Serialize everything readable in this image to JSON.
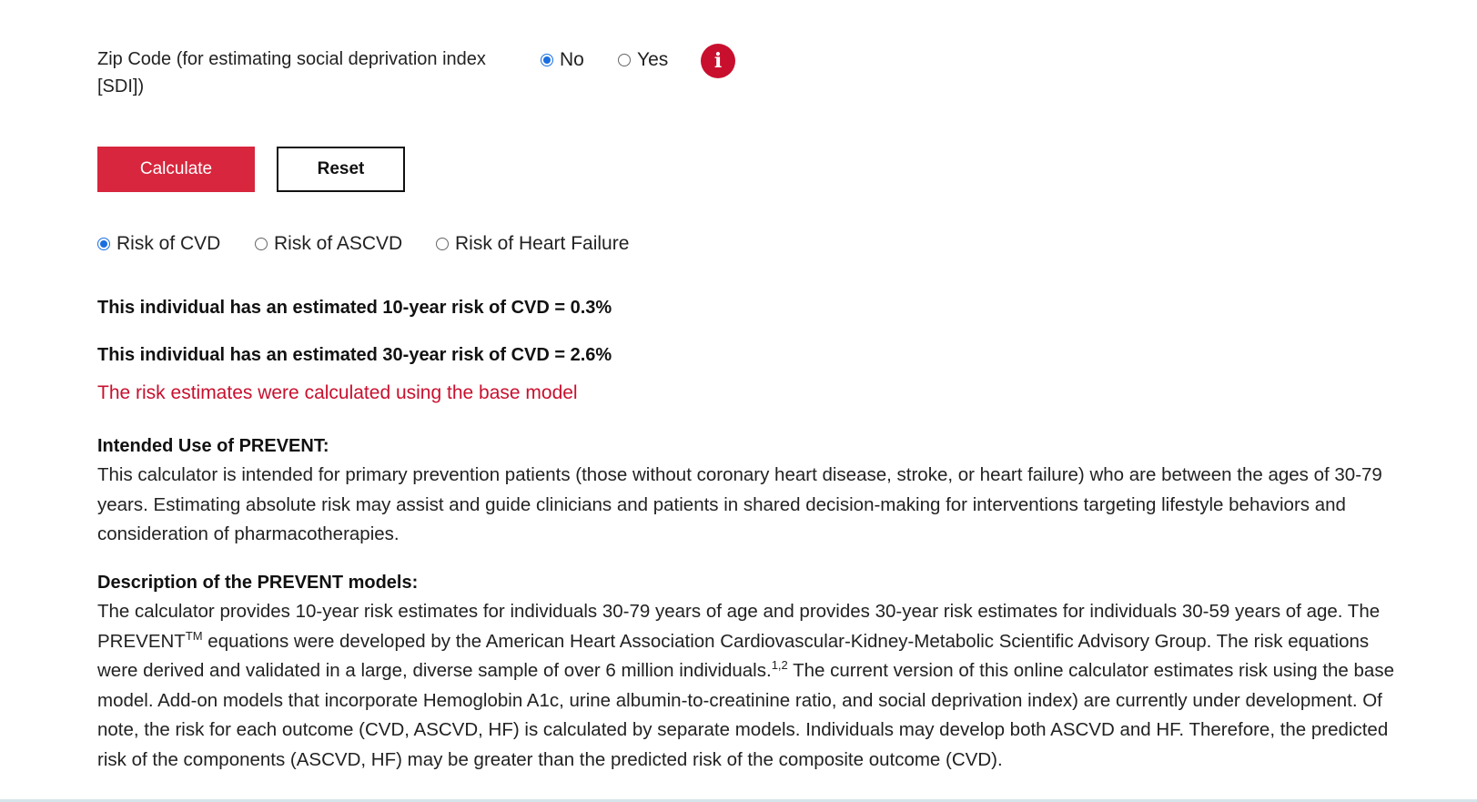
{
  "zip": {
    "label": "Zip Code (for estimating social deprivation index [SDI])",
    "option_no": "No",
    "option_yes": "Yes",
    "selected": "No",
    "info_glyph": "i"
  },
  "buttons": {
    "calculate": "Calculate",
    "reset": "Reset"
  },
  "risk_tabs": {
    "cvd": "Risk of CVD",
    "ascvd": "Risk of ASCVD",
    "hf": "Risk of Heart Failure",
    "selected": "Risk of CVD"
  },
  "results": {
    "ten_year": "This individual has an estimated 10-year risk of CVD = 0.3%",
    "thirty_year": "This individual has an estimated 30-year risk of CVD = 2.6%",
    "model_note": "The risk estimates were calculated using the base model"
  },
  "intended_use": {
    "heading": "Intended Use of PREVENT:",
    "body": "This calculator is intended for primary prevention patients (those without coronary heart disease, stroke, or heart failure) who are between the ages of 30-79 years. Estimating absolute risk may assist and guide clinicians and patients in shared decision-making for interventions targeting lifestyle behaviors and consideration of pharmacotherapies."
  },
  "description": {
    "heading": "Description of the PREVENT models:",
    "part1": "The calculator provides 10-year risk estimates for individuals 30-79 years of age and provides 30-year risk estimates for individuals 30-59 years of age. The PREVENT",
    "tm": "TM",
    "part2": " equations were developed by the American Heart Association Cardiovascular-Kidney-Metabolic Scientific Advisory Group. The risk equations were derived and validated in a large, diverse sample of over 6 million individuals.",
    "refs": "1,2",
    "part3": " The current version of this online calculator estimates risk using the base model. Add-on models that incorporate Hemoglobin A1c, urine albumin-to-creatinine ratio, and social deprivation index) are currently under development. Of note, the risk for each outcome (CVD, ASCVD, HF) is calculated by separate models. Individuals may develop both ASCVD and HF. Therefore, the predicted risk of the components (ASCVD, HF) may be greater than the predicted risk of the composite outcome (CVD)."
  },
  "colors": {
    "accent_red": "#d7263d",
    "radio_blue": "#1a6fe0",
    "note_red": "#c8102e"
  }
}
